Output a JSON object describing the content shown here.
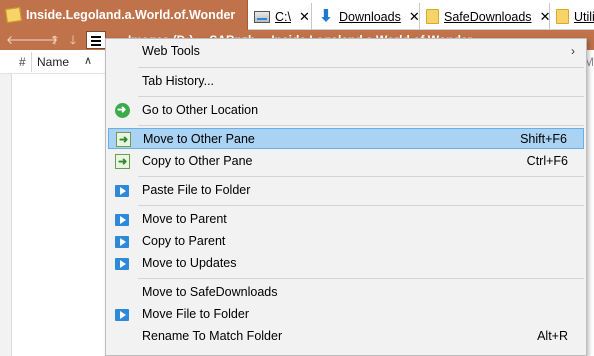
{
  "tabs": [
    {
      "label": "Inside.Legoland.a.World.of.Wonder",
      "icon": "folder-special-icon",
      "active": true
    },
    {
      "label": "C:\\",
      "icon": "drive-icon"
    },
    {
      "label": "Downloads",
      "icon": "download-arrow-icon"
    },
    {
      "label": "SafeDownloads",
      "icon": "folder-icon"
    },
    {
      "label": "Utili",
      "icon": "folder-icon"
    }
  ],
  "address": {
    "crumbs": [
      "Images (D:)",
      "SABnzb",
      "Inside.Legoland.a.World.of.Wonder"
    ]
  },
  "column_header": {
    "hash": "#",
    "name": "Name",
    "right_stub": "Mo"
  },
  "menu": {
    "items": [
      {
        "label": "Web Tools",
        "submenu": true
      },
      {
        "label": "Tab History..."
      },
      {
        "label": "Go to Other Location",
        "icon": "goto-icon"
      },
      {
        "label": "Move to Other Pane",
        "shortcut": "Shift+F6",
        "icon": "move-pane-icon",
        "highlighted": true
      },
      {
        "label": "Copy to Other Pane",
        "shortcut": "Ctrl+F6",
        "icon": "copy-pane-icon"
      },
      {
        "label": "Paste File to Folder",
        "icon": "play-icon"
      },
      {
        "label": "Move to Parent",
        "icon": "play-icon"
      },
      {
        "label": "Copy to Parent",
        "icon": "play-icon"
      },
      {
        "label": "Move to Updates",
        "icon": "play-icon"
      },
      {
        "label": "Move to SafeDownloads"
      },
      {
        "label": "Move File to Folder",
        "icon": "play-icon"
      },
      {
        "label": "Rename To Match Folder",
        "shortcut": "Alt+R"
      }
    ]
  },
  "colors": {
    "accent": "#c0724a",
    "highlight": "#a9d2f3",
    "menu_bg": "#f2f2f2"
  }
}
